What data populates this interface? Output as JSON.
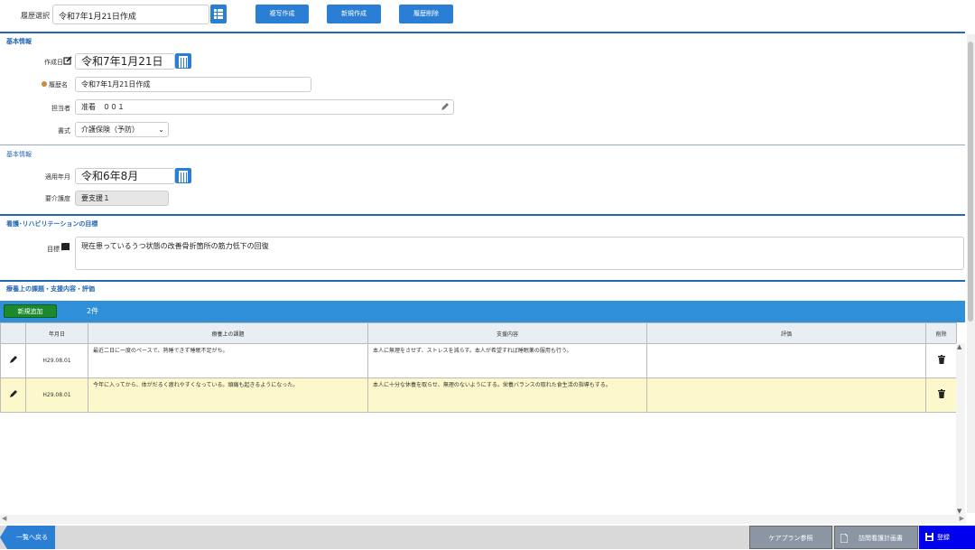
{
  "top": {
    "history_label": "履歴選択",
    "history_value": "令和7年1月21日作成",
    "buttons": [
      "複写作成",
      "新規作成",
      "履歴削除"
    ]
  },
  "basic": {
    "section_title": "基本情報",
    "created_label": "作成日",
    "created_value": "令和7年1月21日",
    "history_name_label": "履歴名",
    "history_name_value": "令和7年1月21日作成",
    "staff_label": "担当者",
    "staff_value": "准看　００１",
    "format_label": "書式",
    "format_value": "介護保険（予防）"
  },
  "basic2": {
    "section_title": "基本情報",
    "month_label": "適用年月",
    "month_value": "令和6年8月",
    "care_label": "要介護度",
    "care_value": "要支援１"
  },
  "goal": {
    "section_title": "看護･リハビリテーションの目標",
    "label": "目標",
    "value": "現在患っているうつ状態の改善骨折箇所の筋力低下の回復"
  },
  "issues": {
    "section_title": "療養上の課題・支援内容・評価",
    "add_label": "新規追加",
    "count": "2件",
    "columns": [
      "年月日",
      "療養上の課題",
      "支援内容",
      "評価",
      "削除"
    ],
    "rows": [
      {
        "date": "H29.08.01",
        "issue": "最近二日に一度のペースで、熟睡できず睡眠不足がち。",
        "support": "本人に無理をさせず、ストレスを減らす。本人が希望すれば睡眠薬の服用も行う。",
        "eval": ""
      },
      {
        "date": "H29.08.01",
        "issue": "今年に入ってから、体がだるく疲れやすくなっている。頭痛も起きるようになった。",
        "support": "本人に十分な休養を取らせ、無理のないようにする。栄養バランスの取れた食生活の指導もする。",
        "eval": ""
      }
    ]
  },
  "footer": {
    "back_label": "一覧へ戻る",
    "careplan_label": "ケアプラン参照",
    "nursing_plan_label": "訪問看護計画書",
    "save_label": "登録"
  },
  "colors": {
    "accent": "#2a7fd4",
    "section": "#2467b2",
    "add": "#1a8a2c",
    "selected_row": "#fdf8cc",
    "save": "#0000ee"
  }
}
